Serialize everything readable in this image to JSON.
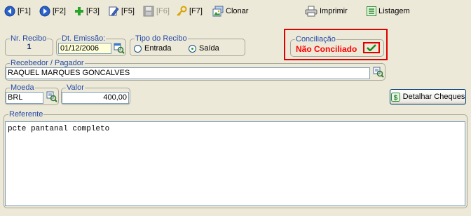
{
  "toolbar": {
    "f1": "[F1]",
    "f2": "[F2]",
    "f3": "[F3]",
    "f5": "[F5]",
    "f6": "[F6]",
    "f7": "[F7]",
    "clonar": "Clonar",
    "imprimir": "Imprimir",
    "listagem": "Listagem"
  },
  "recibo": {
    "label": "Nr. Recibo",
    "value": "1"
  },
  "emissao": {
    "label": "Dt. Emissão:",
    "value": "01/12/2006"
  },
  "tipo": {
    "label": "Tipo do Recibo",
    "options": [
      "Entrada",
      "Saída"
    ],
    "selected": "Saída"
  },
  "conciliacao": {
    "label": "Conciliação",
    "status": "Não Conciliado",
    "status_color": "#ff0000"
  },
  "recebedor": {
    "label": "Recebedor / Pagador",
    "value": "RAQUEL MARQUES GONCALVES"
  },
  "moeda": {
    "label": "Moeda",
    "value": "BRL"
  },
  "valor": {
    "label": "Valor",
    "value": "400,00"
  },
  "detalhar": {
    "label": "Detalhar Cheques"
  },
  "referente": {
    "label": "Referente",
    "value": "pcte pantanal completo"
  },
  "colors": {
    "legend": "#2549a8",
    "highlight_border": "#e00000",
    "window": "#ece9d8"
  }
}
